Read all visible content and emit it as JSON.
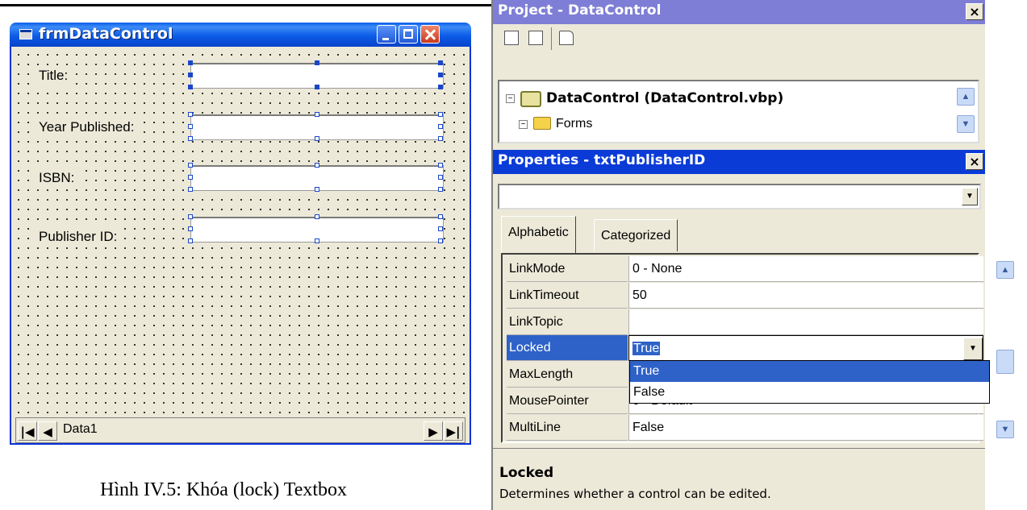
{
  "form": {
    "title": "frmDataControl",
    "labels": [
      "Title:",
      "Year Published:",
      "ISBN:",
      "Publisher ID:"
    ],
    "data_control": {
      "caption": "Data1",
      "first": "|◀",
      "prev": "◀",
      "next": "▶",
      "last": "▶|"
    }
  },
  "caption": "Hình IV.5: Khóa (lock) Textbox",
  "project": {
    "title": "Project - DataControl",
    "close": "×",
    "tree": {
      "project": "DataControl (DataControl.vbp)",
      "folder": "Forms"
    }
  },
  "properties": {
    "title": "Properties - txtPublisherID",
    "close": "×",
    "object_combo_value": "",
    "tabs": [
      "Alphabetic",
      "Categorized"
    ],
    "rows": [
      {
        "name": "LinkMode",
        "value": "0 - None"
      },
      {
        "name": "LinkTimeout",
        "value": "50"
      },
      {
        "name": "LinkTopic",
        "value": ""
      },
      {
        "name": "Locked",
        "value": "True"
      },
      {
        "name": "MaxLength",
        "value": ""
      },
      {
        "name": "MousePointer",
        "value": "0 - Default"
      },
      {
        "name": "MultiLine",
        "value": "False"
      }
    ],
    "dropdown_options": [
      "True",
      "False"
    ],
    "description": {
      "title": "Locked",
      "text": "Determines whether a control can be edited."
    }
  },
  "colors": {
    "titlebar_active": "#0b3bd7",
    "titlebar_inactive": "#7e7ed6",
    "selection": "#2e62c8",
    "xp_blue": "#0a5ee8"
  }
}
